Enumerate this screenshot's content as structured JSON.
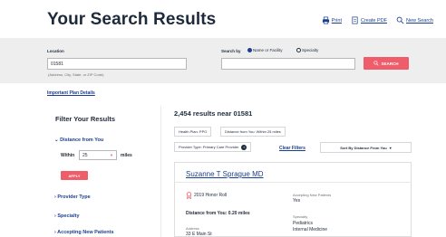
{
  "header": {
    "title": "Your Search Results",
    "links": [
      {
        "label": "Print",
        "icon": "printer-icon"
      },
      {
        "label": "Create PDF",
        "icon": "pdf-icon"
      },
      {
        "label": "New Search",
        "icon": "search-icon"
      }
    ]
  },
  "search": {
    "location_label": "Location",
    "location_value": "01581",
    "location_hint": "(Address, City, State, or ZIP Code)",
    "search_by_label": "Search by",
    "radio_name": "Name or Facility",
    "radio_specialty": "Specialty",
    "selected": "Name or Facility",
    "name_value": "",
    "button_label": "SEARCH"
  },
  "important_link": "Important Plan Details",
  "filters": {
    "title": "Filter Your Results",
    "distance_heading": "Distance from You",
    "within_label": "Within",
    "within_value": "25",
    "miles_label": "miles",
    "apply_label": "APPLY",
    "items": [
      "Provider Type",
      "Specialty",
      "Accepting New Patients"
    ]
  },
  "results": {
    "count_text": "2,454 results near 01581",
    "chips": [
      "Health Plan: PPO",
      "Distance from You: Within 25 miles",
      "Provider Type: Primary Care Provider"
    ],
    "clear_label": "Clear Filters",
    "sort_label": "Sort By Distance From You"
  },
  "provider": {
    "name": "Suzanne T Sprague  MD",
    "honor": "2019 Honor Roll",
    "distance": "Distance from You: 0.20 miles",
    "address_label": "Address",
    "address_value": "33 E Main St",
    "accepting_label": "Accepting New Patients",
    "accepting_value": "Yes",
    "specialty_label": "Specialty",
    "specialties": [
      "Pediatrics",
      "Internal Medicine"
    ]
  },
  "colors": {
    "accent": "#ef5d6a",
    "link": "#1b3f8f",
    "panel": "#eeeeee"
  }
}
